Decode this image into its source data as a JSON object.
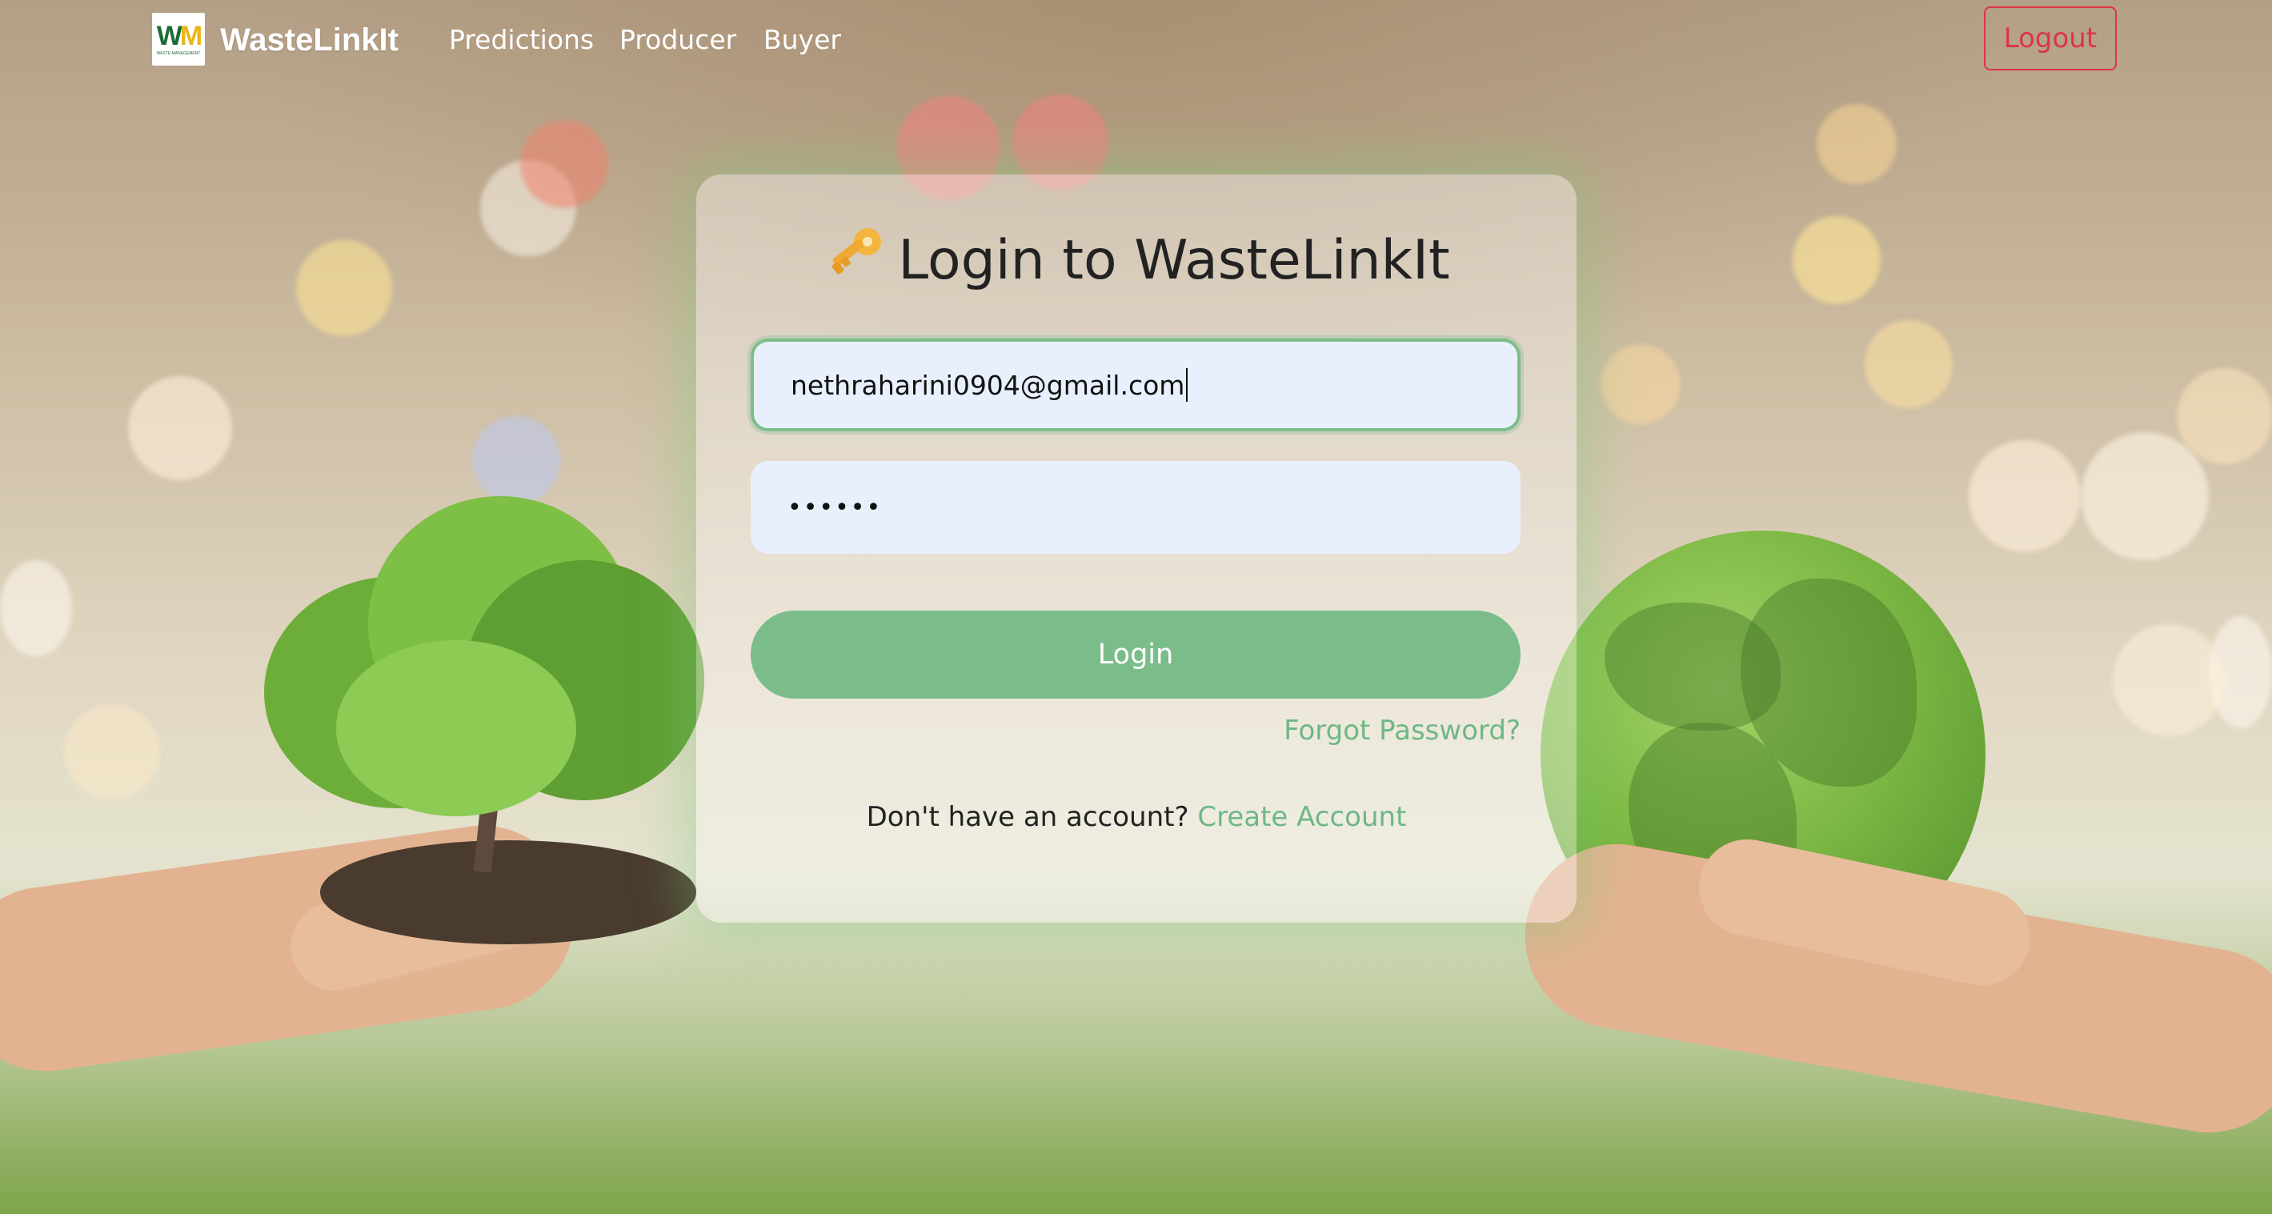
{
  "navbar": {
    "logo_text": "WM",
    "logo_sub": "WASTE MANAGEMENT",
    "brand": "WasteLinkIt",
    "links": [
      "Predictions",
      "Producer",
      "Buyer"
    ],
    "logout": "Logout"
  },
  "login": {
    "key_icon": "key-icon",
    "title": "Login to WasteLinkIt",
    "email_value": "nethraharini0904@gmail.com",
    "password_value": "••••••",
    "button": "Login",
    "forgot": "Forgot Password?",
    "no_account": "Don't have an account?",
    "create_account": "Create Account"
  },
  "colors": {
    "accent_green": "#7abd8a",
    "logout_red": "#dc3545",
    "input_bg": "#e8f0fe"
  }
}
